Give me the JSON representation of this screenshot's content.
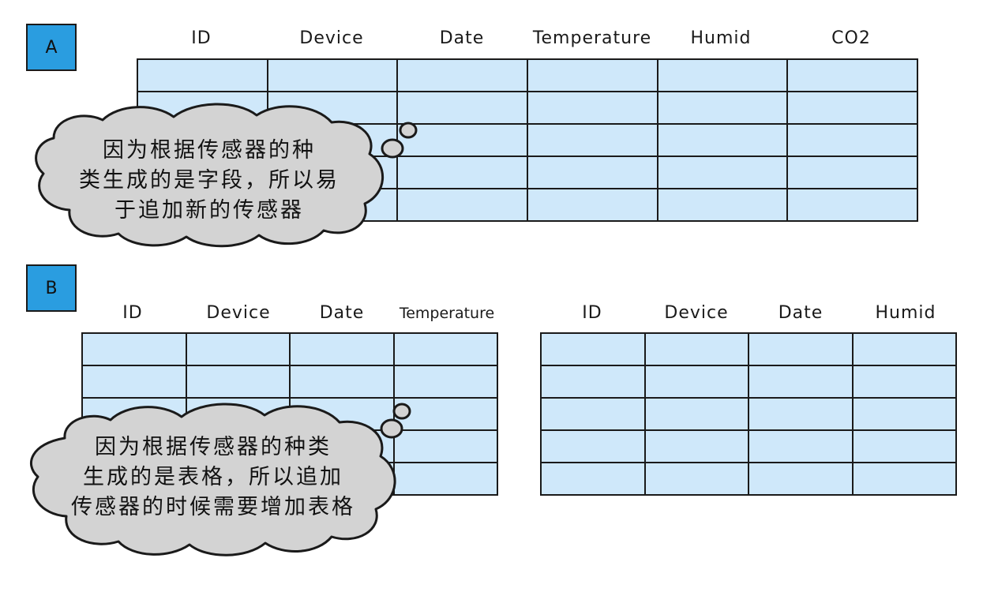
{
  "section_a": {
    "label": "A",
    "columns": [
      "ID",
      "Device",
      "Date",
      "Temperature",
      "Humid",
      "CO2"
    ],
    "row_count": 5,
    "note_lines": [
      "因为根据传感器的种",
      "类生成的是字段，所以易",
      "于追加新的传感器"
    ]
  },
  "section_b": {
    "label": "B",
    "left_columns": [
      "ID",
      "Device",
      "Date",
      "Temperature"
    ],
    "right_columns": [
      "ID",
      "Device",
      "Date",
      "Humid"
    ],
    "row_count": 5,
    "note_lines": [
      "因为根据传感器的种类",
      "生成的是表格，所以追加",
      "传感器的时候需要增加表格"
    ]
  },
  "colors": {
    "badge": "#2a9de0",
    "cell": "#cfe8fa",
    "cloud": "#d3d3d3",
    "stroke": "#1a1a1a"
  }
}
